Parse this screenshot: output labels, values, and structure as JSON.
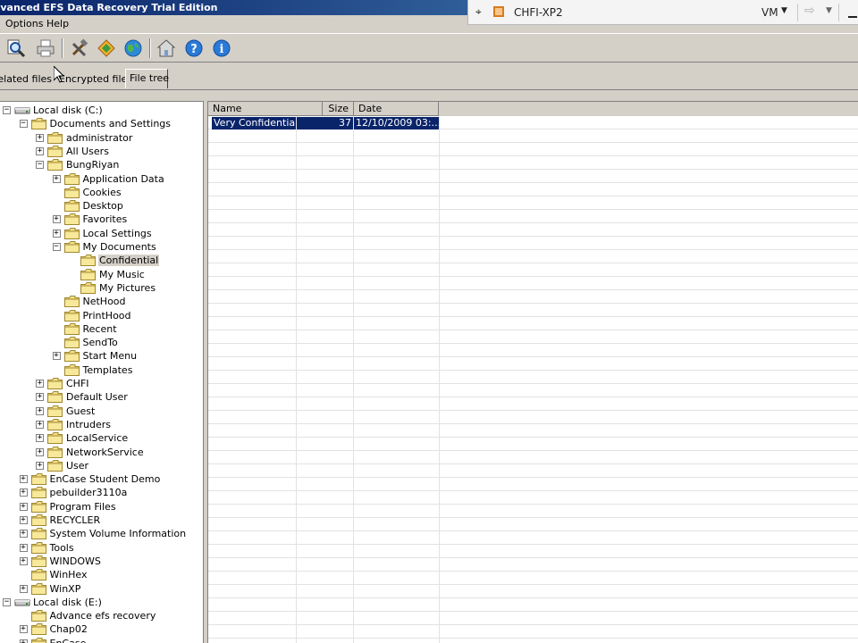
{
  "window": {
    "title": "Advanced EFS Data Recovery Trial Edition"
  },
  "vm_bar": {
    "vm_name": "CHFI-XP2",
    "menu_label": "VM"
  },
  "menu": {
    "options": "Options",
    "help": "Help"
  },
  "tabs": [
    {
      "label": "EFS related files",
      "active": false
    },
    {
      "label": "Encrypted files",
      "active": false
    },
    {
      "label": "File tree",
      "active": true
    }
  ],
  "tree": [
    {
      "label": "Local disk (C:)",
      "level": 0,
      "type": "drive",
      "expander": "minus"
    },
    {
      "label": "Documents and Settings",
      "level": 1,
      "type": "folder",
      "expander": "minus"
    },
    {
      "label": "administrator",
      "level": 2,
      "type": "folder",
      "expander": "plus"
    },
    {
      "label": "All Users",
      "level": 2,
      "type": "folder",
      "expander": "plus"
    },
    {
      "label": "BungRiyan",
      "level": 2,
      "type": "folder",
      "expander": "minus"
    },
    {
      "label": "Application Data",
      "level": 3,
      "type": "folder",
      "expander": "plus"
    },
    {
      "label": "Cookies",
      "level": 3,
      "type": "folder",
      "expander": "none"
    },
    {
      "label": "Desktop",
      "level": 3,
      "type": "folder",
      "expander": "none"
    },
    {
      "label": "Favorites",
      "level": 3,
      "type": "folder",
      "expander": "plus"
    },
    {
      "label": "Local Settings",
      "level": 3,
      "type": "folder",
      "expander": "plus"
    },
    {
      "label": "My Documents",
      "level": 3,
      "type": "folder",
      "expander": "minus"
    },
    {
      "label": "Confidential",
      "level": 4,
      "type": "folder",
      "expander": "none",
      "selected": true
    },
    {
      "label": "My Music",
      "level": 4,
      "type": "folder",
      "expander": "none"
    },
    {
      "label": "My Pictures",
      "level": 4,
      "type": "folder",
      "expander": "none"
    },
    {
      "label": "NetHood",
      "level": 3,
      "type": "folder",
      "expander": "none"
    },
    {
      "label": "PrintHood",
      "level": 3,
      "type": "folder",
      "expander": "none"
    },
    {
      "label": "Recent",
      "level": 3,
      "type": "folder",
      "expander": "none"
    },
    {
      "label": "SendTo",
      "level": 3,
      "type": "folder",
      "expander": "none"
    },
    {
      "label": "Start Menu",
      "level": 3,
      "type": "folder",
      "expander": "plus"
    },
    {
      "label": "Templates",
      "level": 3,
      "type": "folder",
      "expander": "none"
    },
    {
      "label": "CHFI",
      "level": 2,
      "type": "folder",
      "expander": "plus"
    },
    {
      "label": "Default User",
      "level": 2,
      "type": "folder",
      "expander": "plus"
    },
    {
      "label": "Guest",
      "level": 2,
      "type": "folder",
      "expander": "plus"
    },
    {
      "label": "Intruders",
      "level": 2,
      "type": "folder",
      "expander": "plus"
    },
    {
      "label": "LocalService",
      "level": 2,
      "type": "folder",
      "expander": "plus"
    },
    {
      "label": "NetworkService",
      "level": 2,
      "type": "folder",
      "expander": "plus"
    },
    {
      "label": "User",
      "level": 2,
      "type": "folder",
      "expander": "plus"
    },
    {
      "label": "EnCase Student Demo",
      "level": 1,
      "type": "folder",
      "expander": "plus"
    },
    {
      "label": "pebuilder3110a",
      "level": 1,
      "type": "folder",
      "expander": "plus"
    },
    {
      "label": "Program Files",
      "level": 1,
      "type": "folder",
      "expander": "plus"
    },
    {
      "label": "RECYCLER",
      "level": 1,
      "type": "folder",
      "expander": "plus"
    },
    {
      "label": "System Volume Information",
      "level": 1,
      "type": "folder",
      "expander": "plus"
    },
    {
      "label": "Tools",
      "level": 1,
      "type": "folder",
      "expander": "plus"
    },
    {
      "label": "WINDOWS",
      "level": 1,
      "type": "folder",
      "expander": "plus"
    },
    {
      "label": "WinHex",
      "level": 1,
      "type": "folder",
      "expander": "none"
    },
    {
      "label": "WinXP",
      "level": 1,
      "type": "folder",
      "expander": "plus"
    },
    {
      "label": "Local disk (E:)",
      "level": 0,
      "type": "drive",
      "expander": "minus"
    },
    {
      "label": "Advance efs recovery",
      "level": 1,
      "type": "folder",
      "expander": "none"
    },
    {
      "label": "Chap02",
      "level": 1,
      "type": "folder",
      "expander": "plus"
    },
    {
      "label": "EnCase",
      "level": 1,
      "type": "folder",
      "expander": "plus"
    }
  ],
  "file_list": {
    "columns": [
      "Name",
      "Size",
      "Date"
    ],
    "rows": [
      {
        "name": "Very Confidential....",
        "size": "37",
        "date": "12/10/2009 03:...",
        "selected": true
      }
    ]
  },
  "colors": {
    "selection": "#0a246a",
    "chrome": "#d4d0c8",
    "folder": "#f5e086"
  }
}
